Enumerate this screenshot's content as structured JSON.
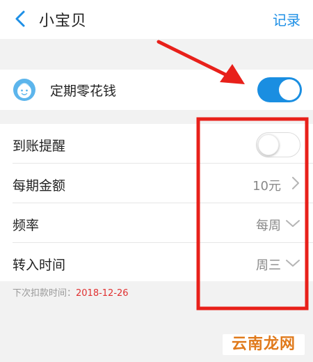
{
  "header": {
    "back_icon": "chevron-left-icon",
    "title": "小宝贝",
    "action_label": "记录"
  },
  "main_toggle": {
    "icon": "baby-face-icon",
    "label": "定期零花钱",
    "state": "on"
  },
  "settings": {
    "arrival_reminder": {
      "label": "到账提醒",
      "state": "off"
    },
    "amount": {
      "label": "每期金额",
      "value": "10元",
      "icon": "chevron-right-icon"
    },
    "frequency": {
      "label": "频率",
      "value": "每周",
      "icon": "chevron-down-icon"
    },
    "transfer_time": {
      "label": "转入时间",
      "value": "周三",
      "icon": "chevron-down-icon"
    }
  },
  "footer_note": {
    "label": "下次扣款时间：",
    "date": "2018-12-26"
  },
  "watermark": "云南龙网",
  "colors": {
    "accent": "#1a8ee1",
    "date_red": "#e03030",
    "annotation_red": "#e8201a",
    "watermark": "#e07a1c"
  }
}
